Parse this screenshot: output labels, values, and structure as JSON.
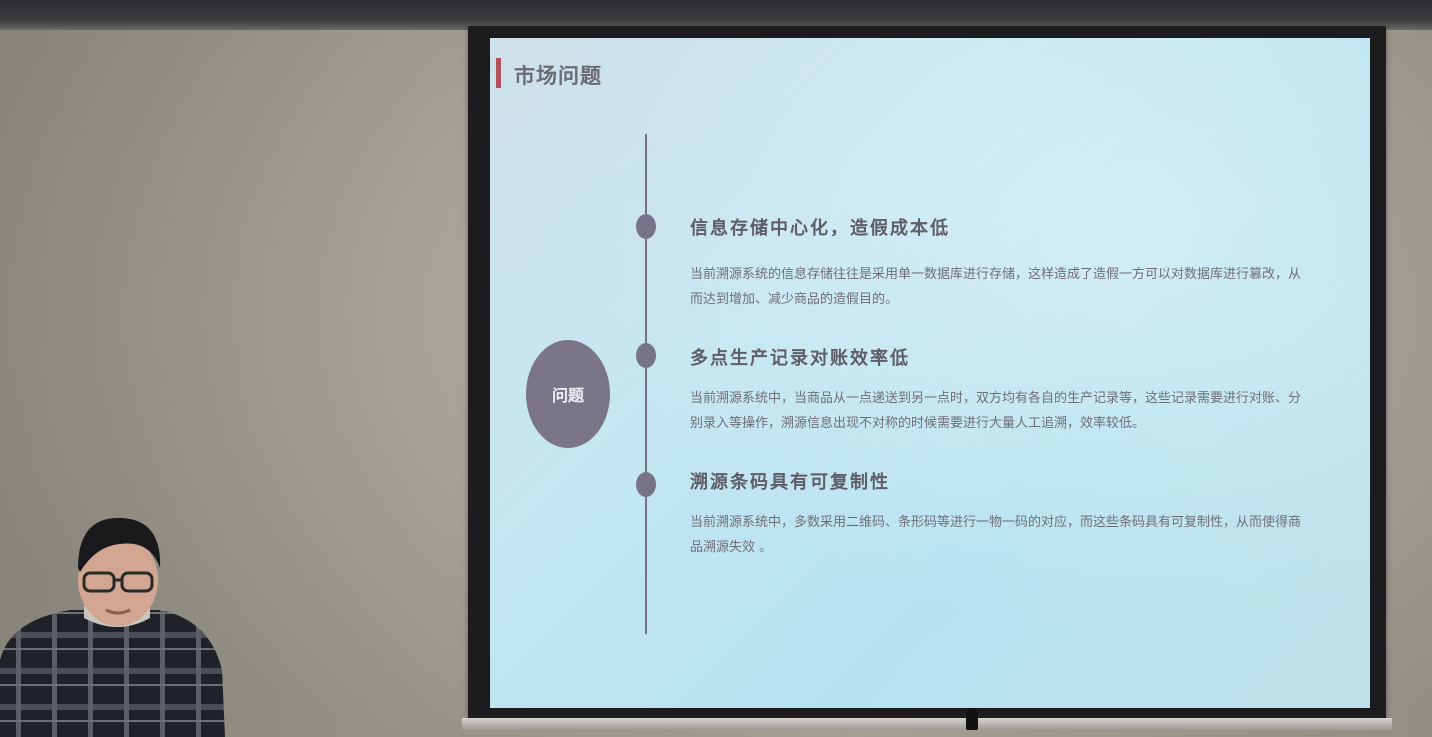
{
  "slide": {
    "title": "市场问题",
    "center_label": "问题",
    "items": [
      {
        "heading": "信息存储中心化，造假成本低",
        "body": "当前溯源系统的信息存储往往是采用单一数据库进行存储，这样造成了造假一方可以对数据库进行篡改，从而达到增加、减少商品的造假目的。"
      },
      {
        "heading": "多点生产记录对账效率低",
        "body": "当前溯源系统中，当商品从一点递送到另一点时，双方均有各自的生产记录等，这些记录需要进行对账、分别录入等操作，溯源信息出现不对称的时候需要进行大量人工追溯，效率较低。"
      },
      {
        "heading": "溯源条码具有可复制性",
        "body": "当前溯源系统中，多数采用二维码、条形码等进行一物一码的对应，而这些条码具有可复制性，从而使得商品溯源失效 。"
      }
    ]
  },
  "colors": {
    "accent": "#b3505a",
    "timeline": "#77738a",
    "slide_bg": "#c4e6f2"
  },
  "icons": {
    "timeline_dot": "circle"
  }
}
